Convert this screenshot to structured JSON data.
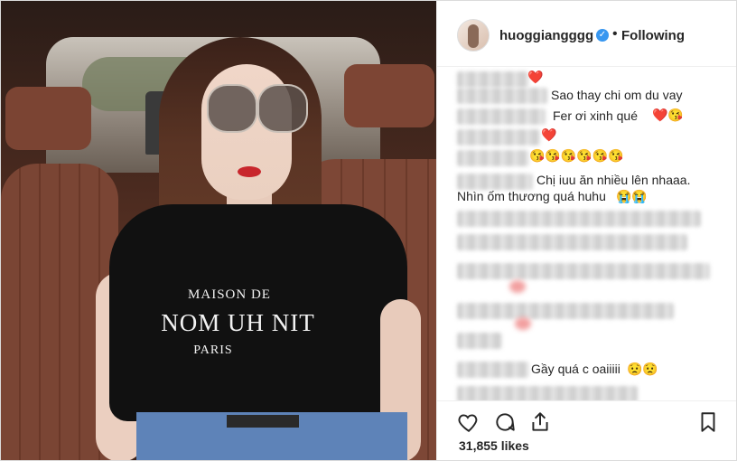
{
  "post": {
    "image_alt": "photo",
    "shirt_text": {
      "line1": "MAISON DE",
      "line2": "NOM UH NIT",
      "line3": "PARIS"
    }
  },
  "header": {
    "username": "huoggiangggg",
    "verified_icon": "verified-badge-icon",
    "separator": "•",
    "follow_status": "Following"
  },
  "comments": [
    {
      "text": "",
      "emoji": "❤️"
    },
    {
      "text": "Sao thay chi om du vay"
    },
    {
      "text": "Fer ơi xinh qué",
      "emoji": "❤️😘"
    },
    {
      "text": "",
      "emoji": "❤️"
    },
    {
      "text": "",
      "emoji": "😘😘😘😘😘😘"
    },
    {
      "text": "Chị iuu ăn nhiều lên nhaaa."
    },
    {
      "text": "Nhìn ốm thương quá huhu",
      "emoji": "😭😭"
    },
    {
      "text": "Gầy quá c oaiiiii",
      "emoji": "😟😟"
    }
  ],
  "actions": {
    "like_icon": "heart-icon",
    "comment_icon": "comment-icon",
    "share_icon": "share-icon",
    "save_icon": "bookmark-icon"
  },
  "likes": "31,855 likes",
  "colors": {
    "link": "#3897f0",
    "text": "#262626",
    "border": "#efefef",
    "heart": "#e0245e"
  }
}
